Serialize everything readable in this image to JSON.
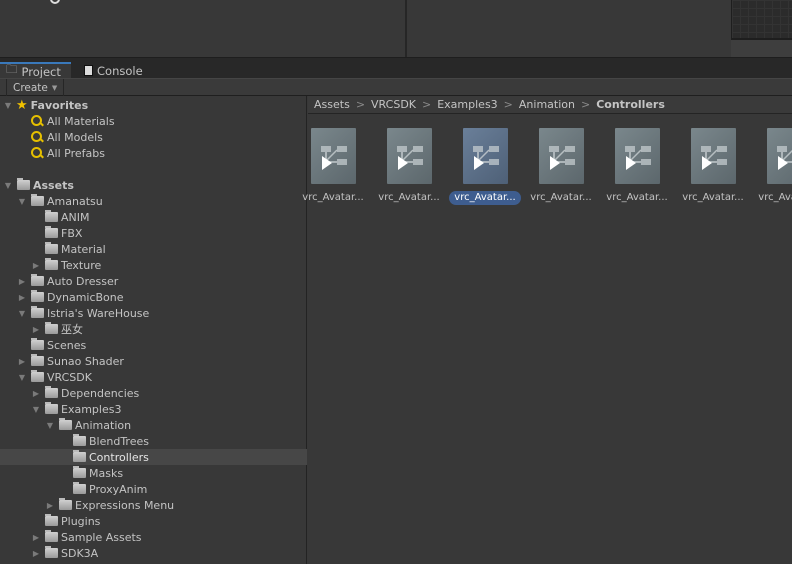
{
  "tabs": [
    {
      "label": "Project",
      "icon": "folder-icon"
    },
    {
      "label": "Console",
      "icon": "console-icon"
    }
  ],
  "toolbar": {
    "create_label": "Create"
  },
  "tree": {
    "favorites": {
      "label": "Favorites",
      "items": [
        "All Materials",
        "All Models",
        "All Prefabs"
      ]
    },
    "assets": [
      {
        "label": "Assets",
        "level": 0,
        "arrow": "expanded",
        "bold": true
      },
      {
        "label": "Amanatsu",
        "level": 1,
        "arrow": "expanded"
      },
      {
        "label": "ANIM",
        "level": 2,
        "arrow": "none"
      },
      {
        "label": "FBX",
        "level": 2,
        "arrow": "none"
      },
      {
        "label": "Material",
        "level": 2,
        "arrow": "none"
      },
      {
        "label": "Texture",
        "level": 2,
        "arrow": "collapsed"
      },
      {
        "label": "Auto Dresser",
        "level": 1,
        "arrow": "collapsed"
      },
      {
        "label": "DynamicBone",
        "level": 1,
        "arrow": "collapsed"
      },
      {
        "label": "Istria's WareHouse",
        "level": 1,
        "arrow": "expanded"
      },
      {
        "label": "巫女",
        "level": 2,
        "arrow": "collapsed"
      },
      {
        "label": "Scenes",
        "level": 1,
        "arrow": "none"
      },
      {
        "label": "Sunao Shader",
        "level": 1,
        "arrow": "collapsed"
      },
      {
        "label": "VRCSDK",
        "level": 1,
        "arrow": "expanded"
      },
      {
        "label": "Dependencies",
        "level": 2,
        "arrow": "collapsed"
      },
      {
        "label": "Examples3",
        "level": 2,
        "arrow": "expanded"
      },
      {
        "label": "Animation",
        "level": 3,
        "arrow": "expanded"
      },
      {
        "label": "BlendTrees",
        "level": 4,
        "arrow": "none"
      },
      {
        "label": "Controllers",
        "level": 4,
        "arrow": "none",
        "selected": true
      },
      {
        "label": "Masks",
        "level": 4,
        "arrow": "none"
      },
      {
        "label": "ProxyAnim",
        "level": 4,
        "arrow": "none"
      },
      {
        "label": "Expressions Menu",
        "level": 3,
        "arrow": "collapsed"
      },
      {
        "label": "Plugins",
        "level": 2,
        "arrow": "none"
      },
      {
        "label": "Sample Assets",
        "level": 2,
        "arrow": "collapsed"
      },
      {
        "label": "SDK3A",
        "level": 2,
        "arrow": "collapsed"
      }
    ]
  },
  "breadcrumb": [
    "Assets",
    "VRCSDK",
    "Examples3",
    "Animation",
    "Controllers"
  ],
  "assets": [
    {
      "label": "vrc_Avatar...",
      "selected": false
    },
    {
      "label": "vrc_Avatar...",
      "selected": false
    },
    {
      "label": "vrc_Avatar...",
      "selected": true
    },
    {
      "label": "vrc_Avatar...",
      "selected": false
    },
    {
      "label": "vrc_Avatar...",
      "selected": false
    },
    {
      "label": "vrc_Avatar...",
      "selected": false
    },
    {
      "label": "vrc_Avatar...",
      "selected": false
    }
  ],
  "colors": {
    "accent": "#3a79bb",
    "selection": "#3e5d8f",
    "star": "#f2c200"
  }
}
